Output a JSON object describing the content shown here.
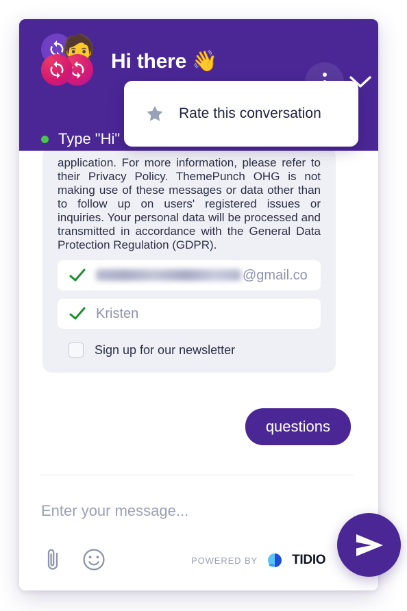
{
  "widget": {
    "header": {
      "title": "Hi there",
      "title_emoji": "👋",
      "avatar": {
        "face_emoji": "🧑",
        "loop_icon": "refresh-loop-icon"
      },
      "menu_icon": "kebab-menu-icon",
      "minimize_icon": "chevron-down-icon",
      "status": {
        "dot_color": "#49c64b",
        "text": "Type \"Hi\""
      },
      "background_color": "#4a2795"
    },
    "dropdown": {
      "star_icon": "star-icon",
      "items": [
        {
          "label": "Rate this conversation"
        }
      ]
    },
    "messages": {
      "bot_message": {
        "text": "application. For more information, please refer to their Privacy Policy. ThemePunch OHG is not making use of these messages or data other than to follow up on users' registered issues or inquiries. Your personal data will be processed and transmitted in accordance with the General Data Protection Regulation (GDPR).",
        "form": {
          "fields": [
            {
              "name": "email",
              "value_suffix": "@gmail.co",
              "redacted": true,
              "valid_icon": "check-icon",
              "valid_color": "#1a8f2e"
            },
            {
              "name": "name",
              "value": "Kristen",
              "redacted": false,
              "valid_icon": "check-icon",
              "valid_color": "#1a8f2e"
            }
          ],
          "checkbox": {
            "label": "Sign up for our newsletter",
            "checked": false
          }
        }
      },
      "user_message": {
        "text": "questions"
      }
    },
    "composer": {
      "placeholder": "Enter your message...",
      "attach_icon": "paperclip-icon",
      "emoji_icon": "smiley-face-icon",
      "send_icon": "send-paper-plane-icon",
      "powered_by_label": "POWERED BY",
      "brand_name": "TIDIO"
    },
    "colors": {
      "brand_purple": "#4a2795",
      "bubble_gray": "#eff0f5",
      "text_dark": "#2c2f45",
      "text_muted": "#9a9fb5"
    }
  }
}
